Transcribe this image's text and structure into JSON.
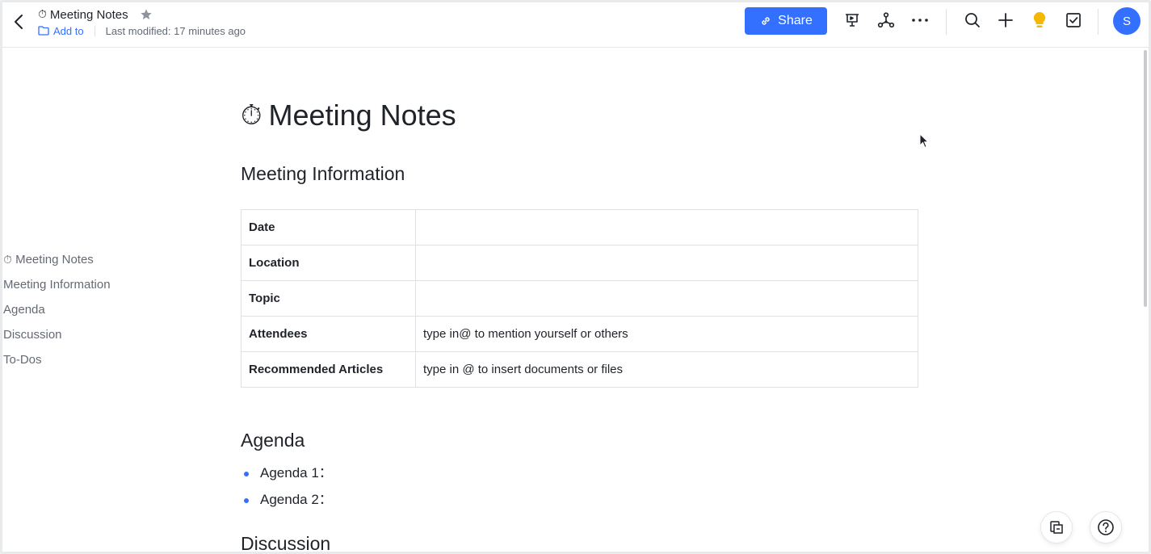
{
  "header": {
    "doc_emoji": "⏱",
    "doc_title": "Meeting Notes",
    "add_to_label": "Add to",
    "last_modified": "Last modified: 17 minutes ago",
    "share_label": "Share",
    "avatar_initial": "S",
    "icons": [
      "back-icon",
      "star-icon",
      "folder-icon",
      "link-icon",
      "presentation-icon",
      "mindmap-icon",
      "more-icon",
      "search-icon",
      "plus-icon",
      "lightbulb-icon",
      "checkbox-icon"
    ],
    "accent_color": "#3370ff",
    "bulb_color": "#f5b800"
  },
  "outline": {
    "items": [
      {
        "emoji": "⏱",
        "label": "Meeting Notes"
      },
      {
        "emoji": "",
        "label": "Meeting Information"
      },
      {
        "emoji": "",
        "label": "Agenda"
      },
      {
        "emoji": "",
        "label": "Discussion"
      },
      {
        "emoji": "",
        "label": "To-Dos"
      }
    ]
  },
  "document": {
    "title_emoji": "⏱",
    "title": "Meeting Notes",
    "section_info": "Meeting Information",
    "table": [
      {
        "label": "Date",
        "value": ""
      },
      {
        "label": "Location",
        "value": ""
      },
      {
        "label": "Topic",
        "value": ""
      },
      {
        "label": "Attendees",
        "value": "type in@ to mention yourself or others"
      },
      {
        "label": "Recommended Articles",
        "value": "type in @ to insert documents or files"
      }
    ],
    "section_agenda": "Agenda",
    "agenda_items": [
      "Agenda 1：",
      "Agenda 2："
    ],
    "section_discussion": "Discussion"
  }
}
